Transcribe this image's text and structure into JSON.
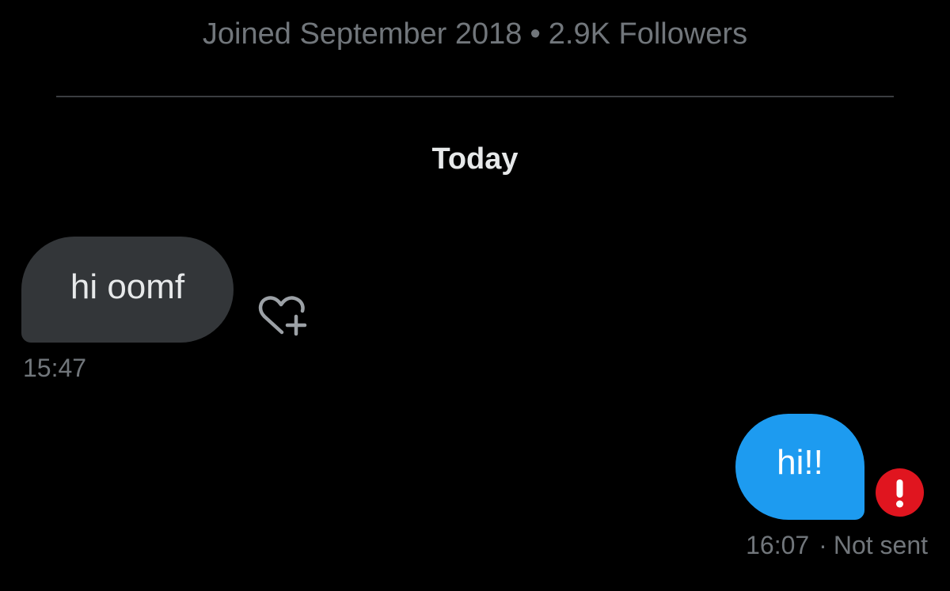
{
  "profile": {
    "joined": "Joined September 2018",
    "separator": "•",
    "followers": "2.9K Followers"
  },
  "conversation": {
    "date_header": "Today",
    "messages": [
      {
        "direction": "received",
        "text": "hi oomf",
        "time": "15:47",
        "react_icon": "heart-plus-icon"
      },
      {
        "direction": "sent",
        "text": "hi!!",
        "time": "16:07",
        "status_separator": "·",
        "status": "Not sent",
        "error_icon": "exclamation-icon"
      }
    ]
  },
  "colors": {
    "background": "#000000",
    "received_bubble": "#333639",
    "sent_bubble": "#1d9bf0",
    "error": "#e0151f",
    "muted_text": "#71767b",
    "primary_text": "#e7e9ea"
  }
}
